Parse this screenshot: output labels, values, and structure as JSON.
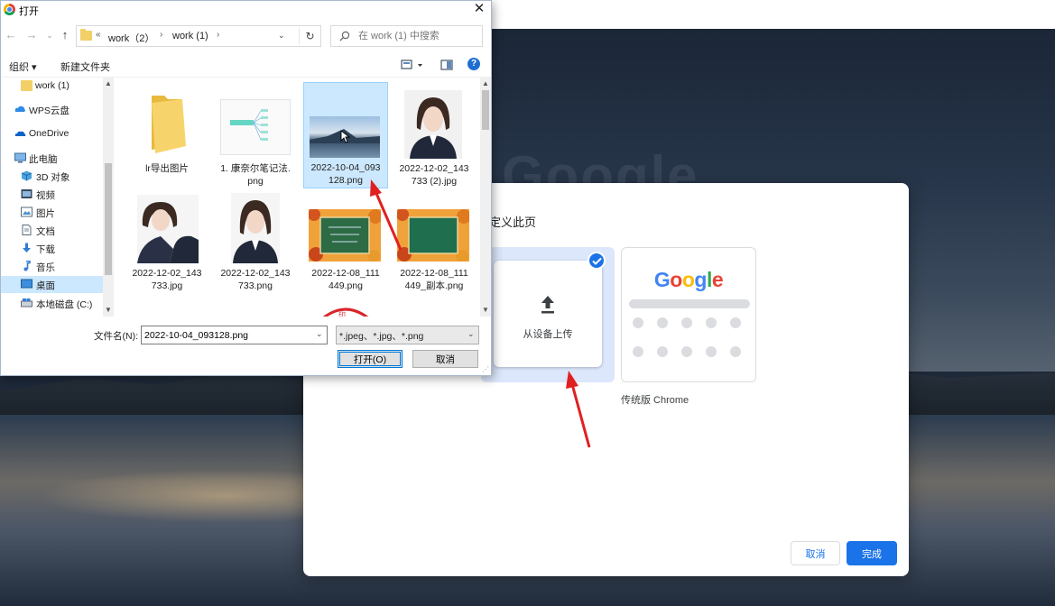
{
  "background": {
    "logo_text": "Google"
  },
  "customize_panel": {
    "title": "定义此页",
    "upload_label": "从设备上传",
    "classic_logo": "Google",
    "classic_label": "传统版 Chrome",
    "cancel_label": "取消",
    "done_label": "完成",
    "accent_color": "#1a73e8"
  },
  "dialog": {
    "title": "打开",
    "close_symbol": "✕",
    "address": {
      "prefix": "«",
      "segments": [
        "work（2）",
        "work (1)"
      ],
      "separator": "›"
    },
    "search": {
      "placeholder": "在 work (1) 中搜索"
    },
    "toolbar": {
      "organize": "组织 ▾",
      "new_folder": "新建文件夹",
      "help": "?"
    },
    "nav_items": [
      {
        "label": "work (1)",
        "icon": "folder-icon"
      },
      {
        "label": "WPS云盘",
        "icon": "cloud-icon"
      },
      {
        "label": "OneDrive",
        "icon": "onedrive-icon"
      },
      {
        "label": "此电脑",
        "icon": "computer-icon"
      },
      {
        "label": "3D 对象",
        "icon": "cube-icon"
      },
      {
        "label": "视频",
        "icon": "video-icon"
      },
      {
        "label": "图片",
        "icon": "picture-icon"
      },
      {
        "label": "文档",
        "icon": "document-icon"
      },
      {
        "label": "下载",
        "icon": "download-icon"
      },
      {
        "label": "音乐",
        "icon": "music-icon"
      },
      {
        "label": "桌面",
        "icon": "desktop-icon"
      },
      {
        "label": "本地磁盘 (C:)",
        "icon": "drive-icon"
      }
    ],
    "files": [
      {
        "name1": "lr导出图片",
        "name2": "",
        "kind": "folder"
      },
      {
        "name1": "1. 康奈尔笔记法.",
        "name2": "png",
        "kind": "mindmap"
      },
      {
        "name1": "2022-10-04_093",
        "name2": "128.png",
        "kind": "landscape"
      },
      {
        "name1": "2022-12-02_143",
        "name2": "733 (2).jpg",
        "kind": "portrait"
      },
      {
        "name1": "2022-12-02_143",
        "name2": "733.jpg",
        "kind": "portrait"
      },
      {
        "name1": "2022-12-02_143",
        "name2": "733.png",
        "kind": "portrait"
      },
      {
        "name1": "2022-12-08_111",
        "name2": "449.png",
        "kind": "chalkboard"
      },
      {
        "name1": "2022-12-08_111",
        "name2": "449_副本.png",
        "kind": "chalkboard"
      },
      {
        "name1": "",
        "name2": "",
        "kind": "seal"
      }
    ],
    "filename_label": "文件名(N):",
    "filename_value": "2022-10-04_093128.png",
    "filetype_value": "*.jpeg、*.jpg、*.png",
    "open_label": "打开(O)",
    "cancel_label": "取消"
  },
  "annotation_color": "#e02020"
}
